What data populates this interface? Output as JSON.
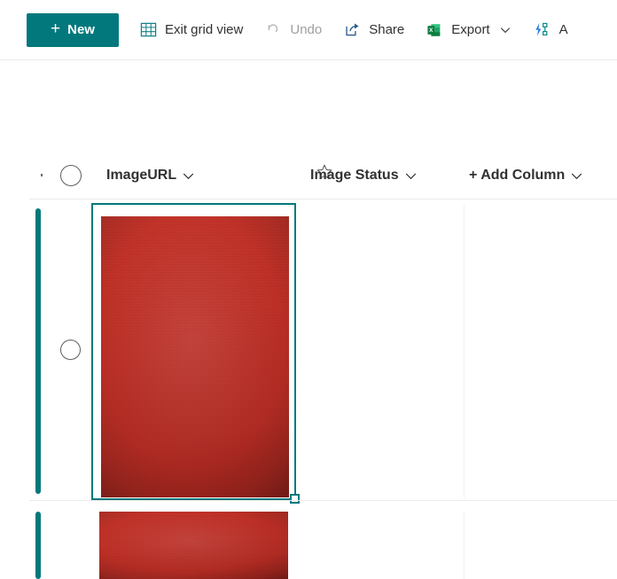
{
  "colors": {
    "accent_teal": "#03787c",
    "excel_green": "#1e7145",
    "text_primary": "#323130",
    "text_disabled": "#a19f9d",
    "divider": "#edebe9",
    "image_red": "#bc2f26"
  },
  "toolbar": {
    "new_button": {
      "label": "New",
      "plus_glyph": "+",
      "icon": "plus-icon"
    },
    "items": [
      {
        "id": "exit-grid-view",
        "label": "Exit grid view",
        "icon": "grid-table-icon",
        "disabled": false,
        "has_chevron": false
      },
      {
        "id": "undo",
        "label": "Undo",
        "icon": "undo-arrow-icon",
        "disabled": true,
        "has_chevron": false
      },
      {
        "id": "share",
        "label": "Share",
        "icon": "share-icon",
        "disabled": false,
        "has_chevron": false
      },
      {
        "id": "export",
        "label": "Export",
        "icon": "excel-export-icon",
        "disabled": false,
        "has_chevron": true
      },
      {
        "id": "automate",
        "label": "A",
        "icon": "automate-flow-icon",
        "disabled": false,
        "has_chevron": false
      }
    ]
  },
  "title_strip": {
    "favorite_icon": "star-outline-icon",
    "ellipsis_dot": "."
  },
  "grid": {
    "select_all": {
      "icon": "select-all-circle-icon",
      "checked": false
    },
    "columns": [
      {
        "id": "image-url",
        "label": "ImageURL",
        "chevron": "chevron-down-icon"
      },
      {
        "id": "image-status",
        "label": "Image Status",
        "chevron": "chevron-down-icon"
      },
      {
        "id": "add-column",
        "label": "+ Add Column",
        "chevron": "chevron-down-icon"
      }
    ],
    "rows": [
      {
        "id": "row-1",
        "selected": true,
        "row_select": {
          "icon": "row-select-circle-icon",
          "checked": false
        },
        "cells": {
          "image_url": {
            "type": "image-thumbnail",
            "alt": "red-image-thumbnail"
          },
          "image_status": {
            "value": ""
          }
        }
      },
      {
        "id": "row-2",
        "selected": false,
        "cells": {
          "image_url": {
            "type": "image-thumbnail",
            "alt": "red-image-thumbnail"
          },
          "image_status": {
            "value": ""
          }
        }
      }
    ],
    "selected_cell": {
      "row": "row-1",
      "column": "image-url",
      "fill_handle": "fill-handle"
    }
  }
}
